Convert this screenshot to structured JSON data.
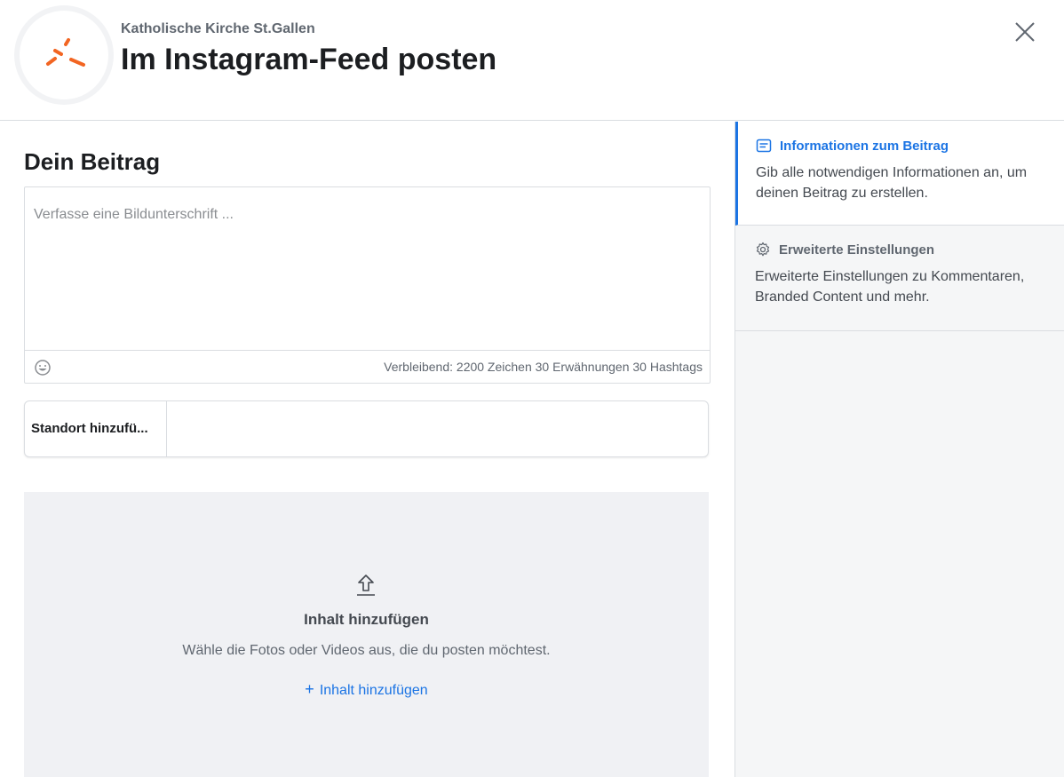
{
  "header": {
    "org_name": "Katholische Kirche St.Gallen",
    "title": "Im Instagram-Feed posten",
    "close_icon": "close-icon"
  },
  "post": {
    "section_title": "Dein Beitrag",
    "caption_placeholder": "Verfasse eine Bildunterschrift ...",
    "caption_value": "",
    "emoji_icon": "emoji-icon",
    "counter_text": "Verbleibend: 2200 Zeichen 30 Erwähnungen 30 Hashtags",
    "location_label": "Standort hinzufü...",
    "location_value": ""
  },
  "upload": {
    "icon": "upload-icon",
    "title": "Inhalt hinzufügen",
    "description": "Wähle die Fotos oder Videos aus, die du posten möchtest.",
    "link_label": "Inhalt hinzufügen"
  },
  "steps": [
    {
      "icon": "post-info-icon",
      "title": "Informationen zum Beitrag",
      "description": "Gib alle notwendigen Informationen an, um deinen Beitrag zu erstellen.",
      "active": true
    },
    {
      "icon": "gear-icon",
      "title": "Erweiterte Einstellungen",
      "description": "Erweiterte Einstellungen zu Kommentaren, Branded Content und mehr.",
      "active": false
    }
  ],
  "colors": {
    "accent": "#1b74e4",
    "logo_orange": "#f26522",
    "upload_bg": "#f0f1f4"
  }
}
